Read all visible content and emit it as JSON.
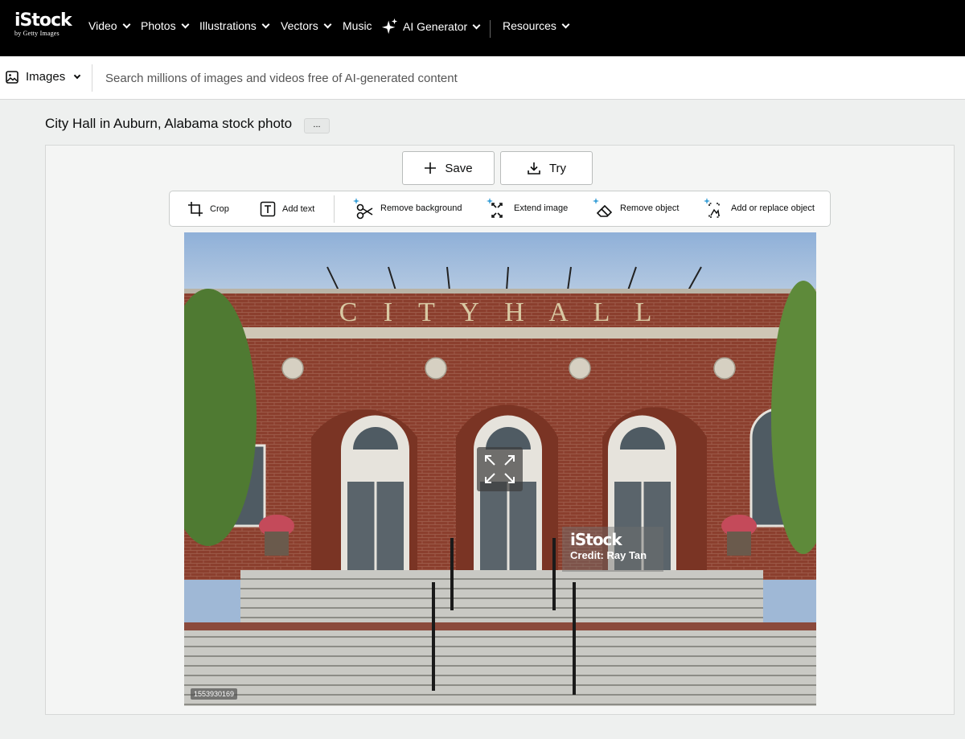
{
  "nav": {
    "logo_text": "iStock",
    "logo_sub": "by Getty Images",
    "items": [
      {
        "label": "Video"
      },
      {
        "label": "Photos"
      },
      {
        "label": "Illustrations"
      },
      {
        "label": "Vectors"
      },
      {
        "label": "Music"
      },
      {
        "label": "AI Generator"
      },
      {
        "label": "Resources"
      }
    ]
  },
  "search": {
    "type_label": "Images",
    "placeholder": "Search millions of images and videos free of AI-generated content"
  },
  "page": {
    "title": "City Hall in Auburn, Alabama stock photo",
    "more_label": "..."
  },
  "actions": {
    "save_label": "Save",
    "try_label": "Try"
  },
  "tools": [
    {
      "label": "Crop",
      "icon": "crop-icon"
    },
    {
      "label": "Add text",
      "icon": "add-text-icon"
    },
    {
      "label": "Remove background",
      "icon": "scissors-icon"
    },
    {
      "label": "Extend image",
      "icon": "expand-icon"
    },
    {
      "label": "Remove object",
      "icon": "eraser-icon"
    },
    {
      "label": "Add or replace object",
      "icon": "replace-object-icon"
    }
  ],
  "photo": {
    "watermark_logo": "iStock",
    "credit": "Credit: Ray Tan",
    "image_id": "1553930169",
    "building_sign": "C I T Y   H A L L"
  },
  "colors": {
    "nav_bg": "#000000",
    "panel_bg": "#f4f5f4",
    "brick": "#8a3f2f",
    "sky": "#9fb8d6"
  }
}
